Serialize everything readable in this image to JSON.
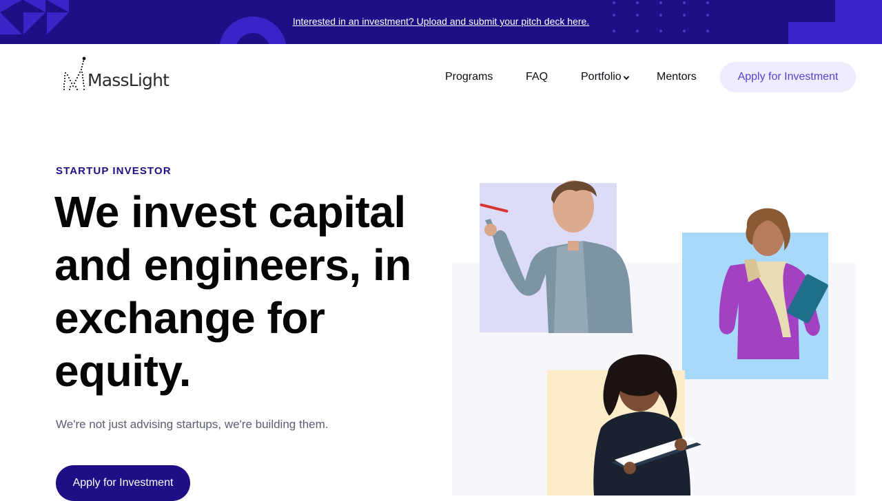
{
  "announcement": {
    "text": "Interested in an investment? Upload and submit your pitch deck here."
  },
  "header": {
    "logo_text": "MassLight",
    "nav": {
      "programs": "Programs",
      "faq": "FAQ",
      "portfolio": "Portfolio",
      "mentors": "Mentors"
    },
    "cta": "Apply for Investment"
  },
  "hero": {
    "eyebrow": "STARTUP INVESTOR",
    "headline": "We invest capital and engineers, in exchange for equity.",
    "subhead": "We're not just advising startups, we're building them.",
    "cta": "Apply for Investment"
  },
  "colors": {
    "brand_navy": "#1f0f86",
    "accent_purple": "#5a3fcf",
    "lavender": "#dcdcf6",
    "sky_blue": "#a8d9fb",
    "cream": "#feebc8"
  },
  "icons": {
    "portfolio_dropdown": "chevron-down-icon",
    "logo": "masslight-logo-mark"
  }
}
